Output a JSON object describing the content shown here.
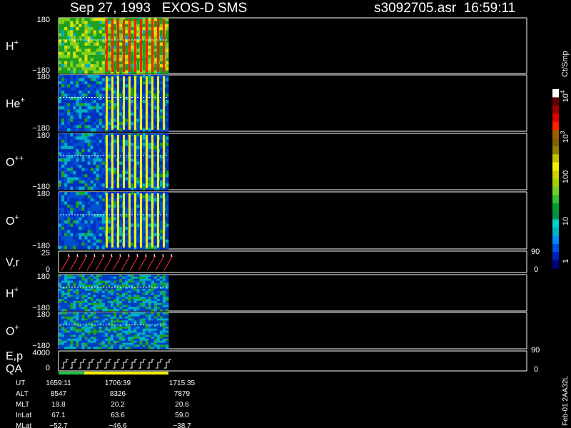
{
  "header": {
    "title": "Sep 27, 1993   EXOS-D SMS",
    "file": "s3092705.asr  16:59:11"
  },
  "colorbar": {
    "unit": "Ct/Smp",
    "labels": [
      "1",
      "10",
      "100",
      "10",
      "10"
    ],
    "exponents": [
      "",
      "",
      "",
      "3",
      "4"
    ],
    "colors": [
      "#000080",
      "#0020c0",
      "#0050e0",
      "#0088ff",
      "#00b0c0",
      "#00d0d0",
      "#009048",
      "#00a030",
      "#30c030",
      "#70d020",
      "#a0d000",
      "#d0d000",
      "#f0f000",
      "#c0c000",
      "#908000",
      "#806000",
      "#a06000",
      "#ff2000",
      "#e00000",
      "#a00000",
      "#600000",
      "#ffffff"
    ]
  },
  "panels": [
    {
      "species": "H",
      "charge": "+",
      "ymax": "180",
      "ymin": "−180",
      "colors": [
        "#20a020",
        "#80d020",
        "#e0e000",
        "#ff2000",
        "#00b0c0"
      ]
    },
    {
      "species": "He",
      "charge": "+",
      "ymax": "180",
      "ymin": "−180",
      "colors": [
        "#0030c0",
        "#0050d0",
        "#00b0c0",
        "#f0f000",
        "#20a020"
      ]
    },
    {
      "species": "O",
      "charge": "++",
      "ymax": "180",
      "ymin": "−180",
      "colors": [
        "#0030c0",
        "#0050d0",
        "#00b0c0",
        "#f0f000",
        "#20a020"
      ]
    },
    {
      "species": "O",
      "charge": "+",
      "ymax": "180",
      "ymin": "−180",
      "colors": [
        "#0030c0",
        "#0050d0",
        "#00b0c0",
        "#f0f000",
        "#20a020"
      ]
    },
    {
      "species": "V,r",
      "charge": "",
      "ymax": "25",
      "ymin": "0",
      "right_top": "90",
      "right_bottom": "0"
    },
    {
      "species": "H",
      "charge": "+",
      "ymax": "180",
      "ymin": "−180",
      "colors": [
        "#0040c0",
        "#00b0c0",
        "#20a020",
        "#60c020",
        "#0060e0"
      ]
    },
    {
      "species": "O",
      "charge": "+",
      "ymax": "180",
      "ymin": "−180",
      "colors": [
        "#0040c0",
        "#00b0c0",
        "#20a020",
        "#60c020",
        "#0060e0"
      ]
    },
    {
      "species": "E,p",
      "species2": "QA",
      "charge": "",
      "ymax": "4000",
      "ymin": "0",
      "right_top": "90",
      "right_bottom": "0"
    }
  ],
  "footer": {
    "rows": [
      {
        "label": "UT",
        "values": [
          "1659:11",
          "1706:39",
          "1715:35"
        ]
      },
      {
        "label": "ALT",
        "values": [
          "8547",
          "8326",
          "7879"
        ]
      },
      {
        "label": "MLT",
        "values": [
          "19.8",
          "20.2",
          "20.6"
        ]
      },
      {
        "label": "InLat",
        "values": [
          "67.1",
          "63.6",
          "59.0"
        ]
      },
      {
        "label": "MLat",
        "values": [
          "−52.7",
          "−46.6",
          "−38.7"
        ]
      }
    ],
    "version": "Feb-01 2AA32L"
  }
}
